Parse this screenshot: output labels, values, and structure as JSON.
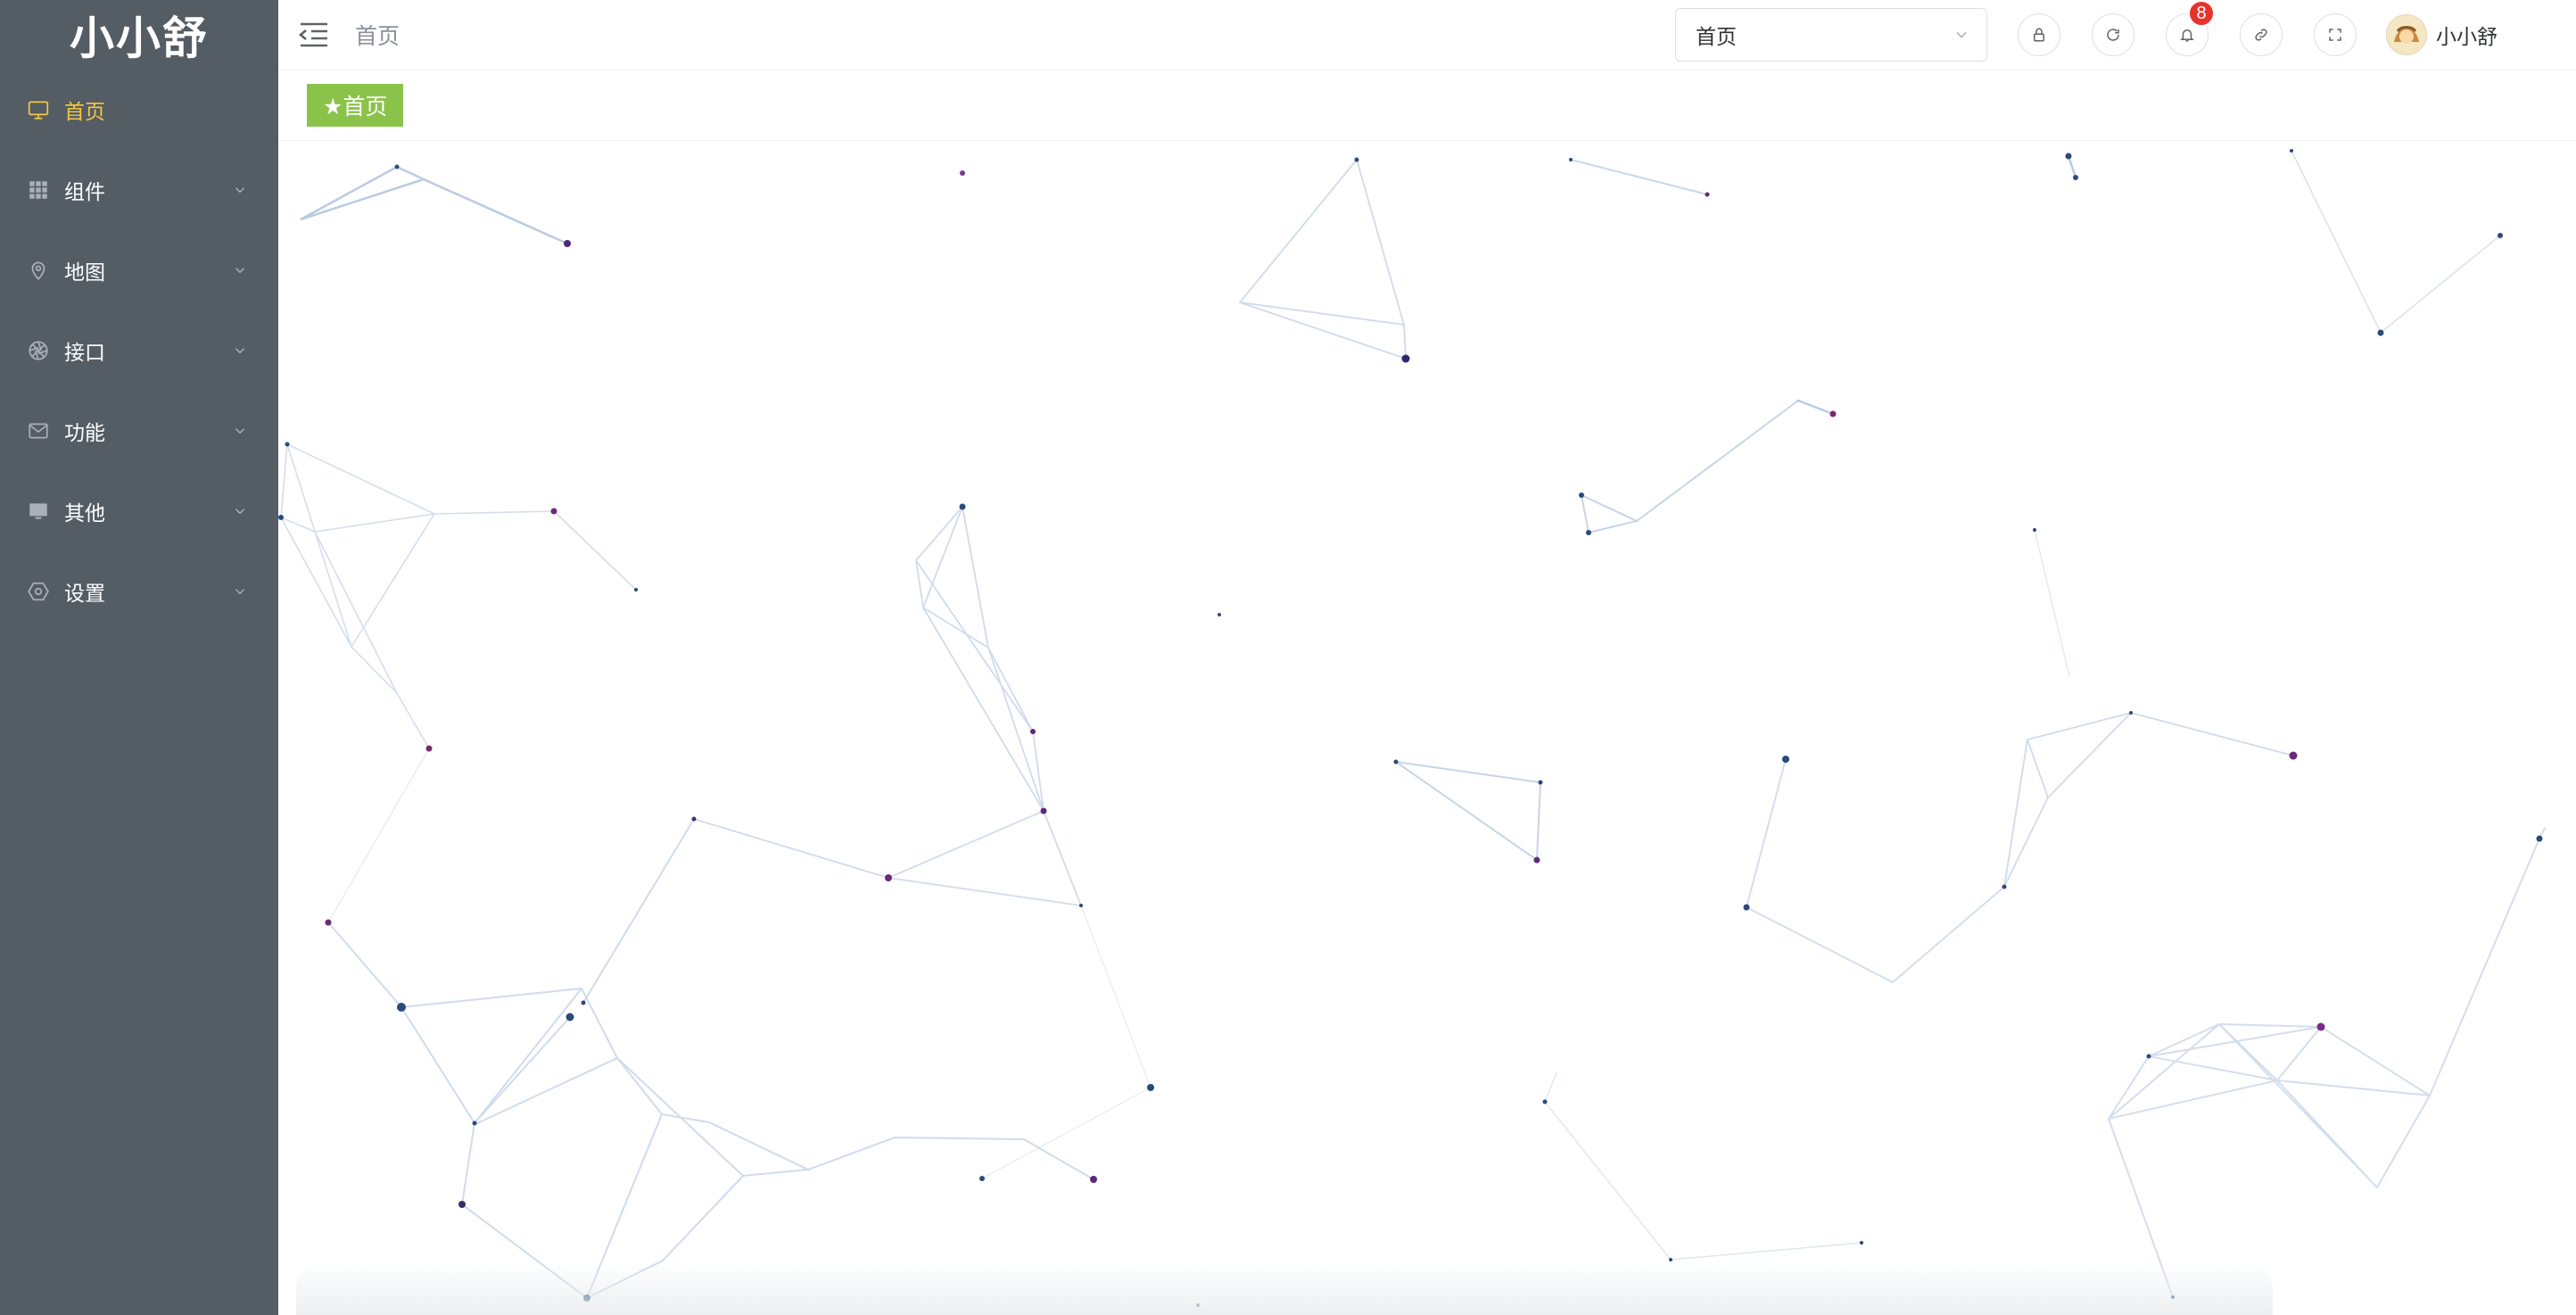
{
  "app": {
    "logo": "小小舒"
  },
  "sidebar": {
    "items": [
      {
        "label": "首页",
        "icon": "monitor-icon",
        "active": true
      },
      {
        "label": "组件",
        "icon": "grid-icon"
      },
      {
        "label": "地图",
        "icon": "map-pin-icon"
      },
      {
        "label": "接口",
        "icon": "aperture-icon"
      },
      {
        "label": "功能",
        "icon": "mail-icon"
      },
      {
        "label": "其他",
        "icon": "screen-icon"
      },
      {
        "label": "设置",
        "icon": "gear-icon"
      }
    ],
    "active_color": "#f5c842",
    "background": "#545c64"
  },
  "header": {
    "breadcrumb": "首页",
    "search_value": "首页",
    "notification_count": "8",
    "username": "小小舒",
    "icons": [
      "lock-icon",
      "refresh-icon",
      "bell-icon",
      "link-icon",
      "fullscreen-icon"
    ]
  },
  "tags": [
    {
      "label": "★首页",
      "color": "#8bc34a"
    }
  ]
}
